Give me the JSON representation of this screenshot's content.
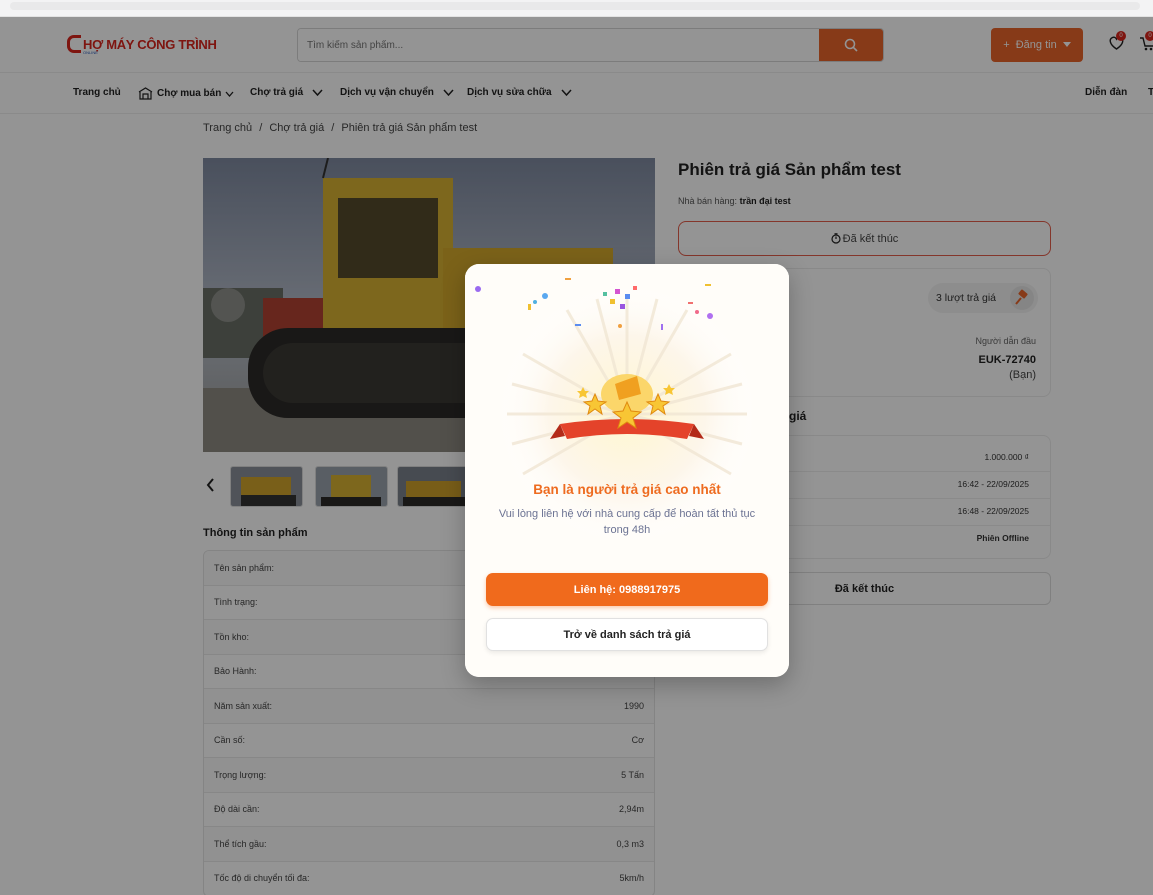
{
  "header": {
    "logo_text": "HỢ MÁY CÔNG TRÌNH",
    "logo_sub": "ONLINE",
    "search_placeholder": "Tìm kiếm sản phẩm...",
    "post_label": "Đăng tin",
    "wishlist_count": "0",
    "cart_count": "0"
  },
  "nav": {
    "items": [
      "Trang chủ",
      "Chợ mua bán",
      "Chợ trả giá",
      "Dịch vụ vận chuyển",
      "Dịch vụ sửa chữa"
    ],
    "right": "Diễn đàn",
    "right_cut": "T"
  },
  "breadcrumb": [
    "Trang chủ",
    "/",
    "Chợ trả giá",
    "/",
    "Phiên trả giá Sản phẩm test"
  ],
  "product": {
    "title": "Phiên trả giá Sản phẩm test",
    "seller_label": "Nhà bán hàng:",
    "seller_name": "trần đại test",
    "status": "Đã kết thúc",
    "bids": "3 lượt trả giá",
    "leader_label": "Người dẫn đầu",
    "leader_code": "EUK-72740",
    "leader_you": "(Bạn)",
    "history_title": "giá",
    "history_values": [
      "1.000.000 ₫",
      "16:42 - 22/09/2025",
      "16:48 - 22/09/2025",
      "Phiên Offline"
    ],
    "bottom_status": "Đã kết thúc"
  },
  "info": {
    "title": "Thông tin sản phẩm",
    "rows": [
      {
        "label": "Tên sản phẩm:",
        "value": ""
      },
      {
        "label": "Tình trạng:",
        "value": ""
      },
      {
        "label": "Tồn kho:",
        "value": ""
      },
      {
        "label": "Bảo Hành:",
        "value": ""
      },
      {
        "label": "Năm sản xuất:",
        "value": "1990"
      },
      {
        "label": "Cần số:",
        "value": "Cơ"
      },
      {
        "label": "Trọng lượng:",
        "value": "5 Tấn"
      },
      {
        "label": "Độ dài cần:",
        "value": "2,94m"
      },
      {
        "label": "Thể tích gầu:",
        "value": "0,3 m3"
      },
      {
        "label": "Tốc độ di chuyển tối đa:",
        "value": "5km/h"
      }
    ]
  },
  "modal": {
    "title": "Bạn là người trả giá cao nhất",
    "subtitle": "Vui lòng liên hệ với nhà cung cấp để hoàn tất thủ tục trong 48h",
    "call_label": "Liên hệ: 0988917975",
    "back_label": "Trở về danh sách trả giá"
  },
  "colors": {
    "accent": "#e8642a",
    "brand_red": "#d9251d",
    "modal_title": "#ee6b1f"
  }
}
